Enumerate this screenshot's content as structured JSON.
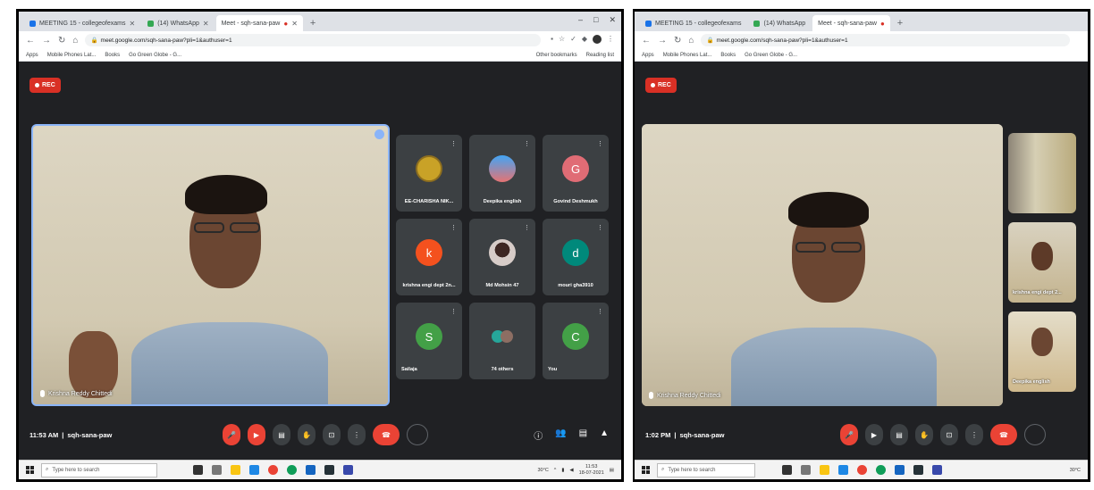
{
  "left": {
    "tabs": [
      {
        "title": "MEETING 15 - collegeofexams",
        "favicon": "blue"
      },
      {
        "title": "(14) WhatsApp",
        "favicon": "green"
      },
      {
        "title": "Meet - sqh-sana-paw",
        "favicon": "meet",
        "recording": true,
        "active": true
      }
    ],
    "url": "meet.google.com/sqh-sana-paw?pli=1&authuser=1",
    "bookmarks": [
      "Apps",
      "Mobile Phones Lat...",
      "Books",
      "Go Green Globe - G..."
    ],
    "bookmarks_right": [
      "Other bookmarks",
      "Reading list"
    ],
    "rec_label": "REC",
    "main_name": "Krishna Reddy Chittedi",
    "participants": [
      {
        "name": "EE-CHARISHA NIK...",
        "kind": "avatar",
        "color": "#c9a227",
        "letter": ""
      },
      {
        "name": "Deepika english",
        "kind": "avatar",
        "color": "#1a73e8",
        "letter": ""
      },
      {
        "name": "Govind Deshmukh",
        "kind": "letter",
        "color": "#e06c75",
        "letter": "G"
      },
      {
        "name": "krishna engi dept 2n...",
        "kind": "letter",
        "color": "#f4511e",
        "letter": "k"
      },
      {
        "name": "Md Mohsin 47",
        "kind": "avatar",
        "color": "#6d4c41",
        "letter": ""
      },
      {
        "name": "mouri gha3910",
        "kind": "letter",
        "color": "#00897b",
        "letter": "d"
      },
      {
        "name": "Sailaja",
        "kind": "letter",
        "color": "#43a047",
        "letter": "S"
      },
      {
        "name": "74 others",
        "kind": "group",
        "color": "#3c4043",
        "letter": ""
      },
      {
        "name": "You",
        "kind": "letter",
        "color": "#43a047",
        "letter": "C"
      }
    ],
    "time": "11:53 AM",
    "meeting_code": "sqh-sana-paw",
    "taskbar_search": "Type here to search",
    "weather": "30°C",
    "clock_time": "11:53",
    "clock_date": "18-07-2021"
  },
  "right": {
    "tabs": [
      {
        "title": "MEETING 15 - collegeofexams",
        "favicon": "blue"
      },
      {
        "title": "(14) WhatsApp",
        "favicon": "green"
      },
      {
        "title": "Meet - sqh-sana-paw",
        "favicon": "meet",
        "recording": true,
        "active": true
      }
    ],
    "url": "meet.google.com/sqh-sana-paw?pli=1&authuser=1",
    "bookmarks": [
      "Apps",
      "Mobile Phones Lat...",
      "Books",
      "Go Green Globe - G..."
    ],
    "rec_label": "REC",
    "main_name": "Krishna Reddy Chittedi",
    "side_names": [
      "",
      "krishna engi dept 2...",
      "Deepika english"
    ],
    "time": "1:02 PM",
    "meeting_code": "sqh-sana-paw",
    "taskbar_search": "Type here to search",
    "weather": "30°C"
  },
  "icons": [
    "back-icon",
    "forward-icon",
    "reload-icon",
    "home-icon",
    "mic-off-icon",
    "camera-off-icon",
    "captions-icon",
    "hand-icon",
    "present-icon",
    "more-icon",
    "hangup-icon",
    "info-icon",
    "people-icon",
    "chat-icon",
    "activities-icon"
  ]
}
